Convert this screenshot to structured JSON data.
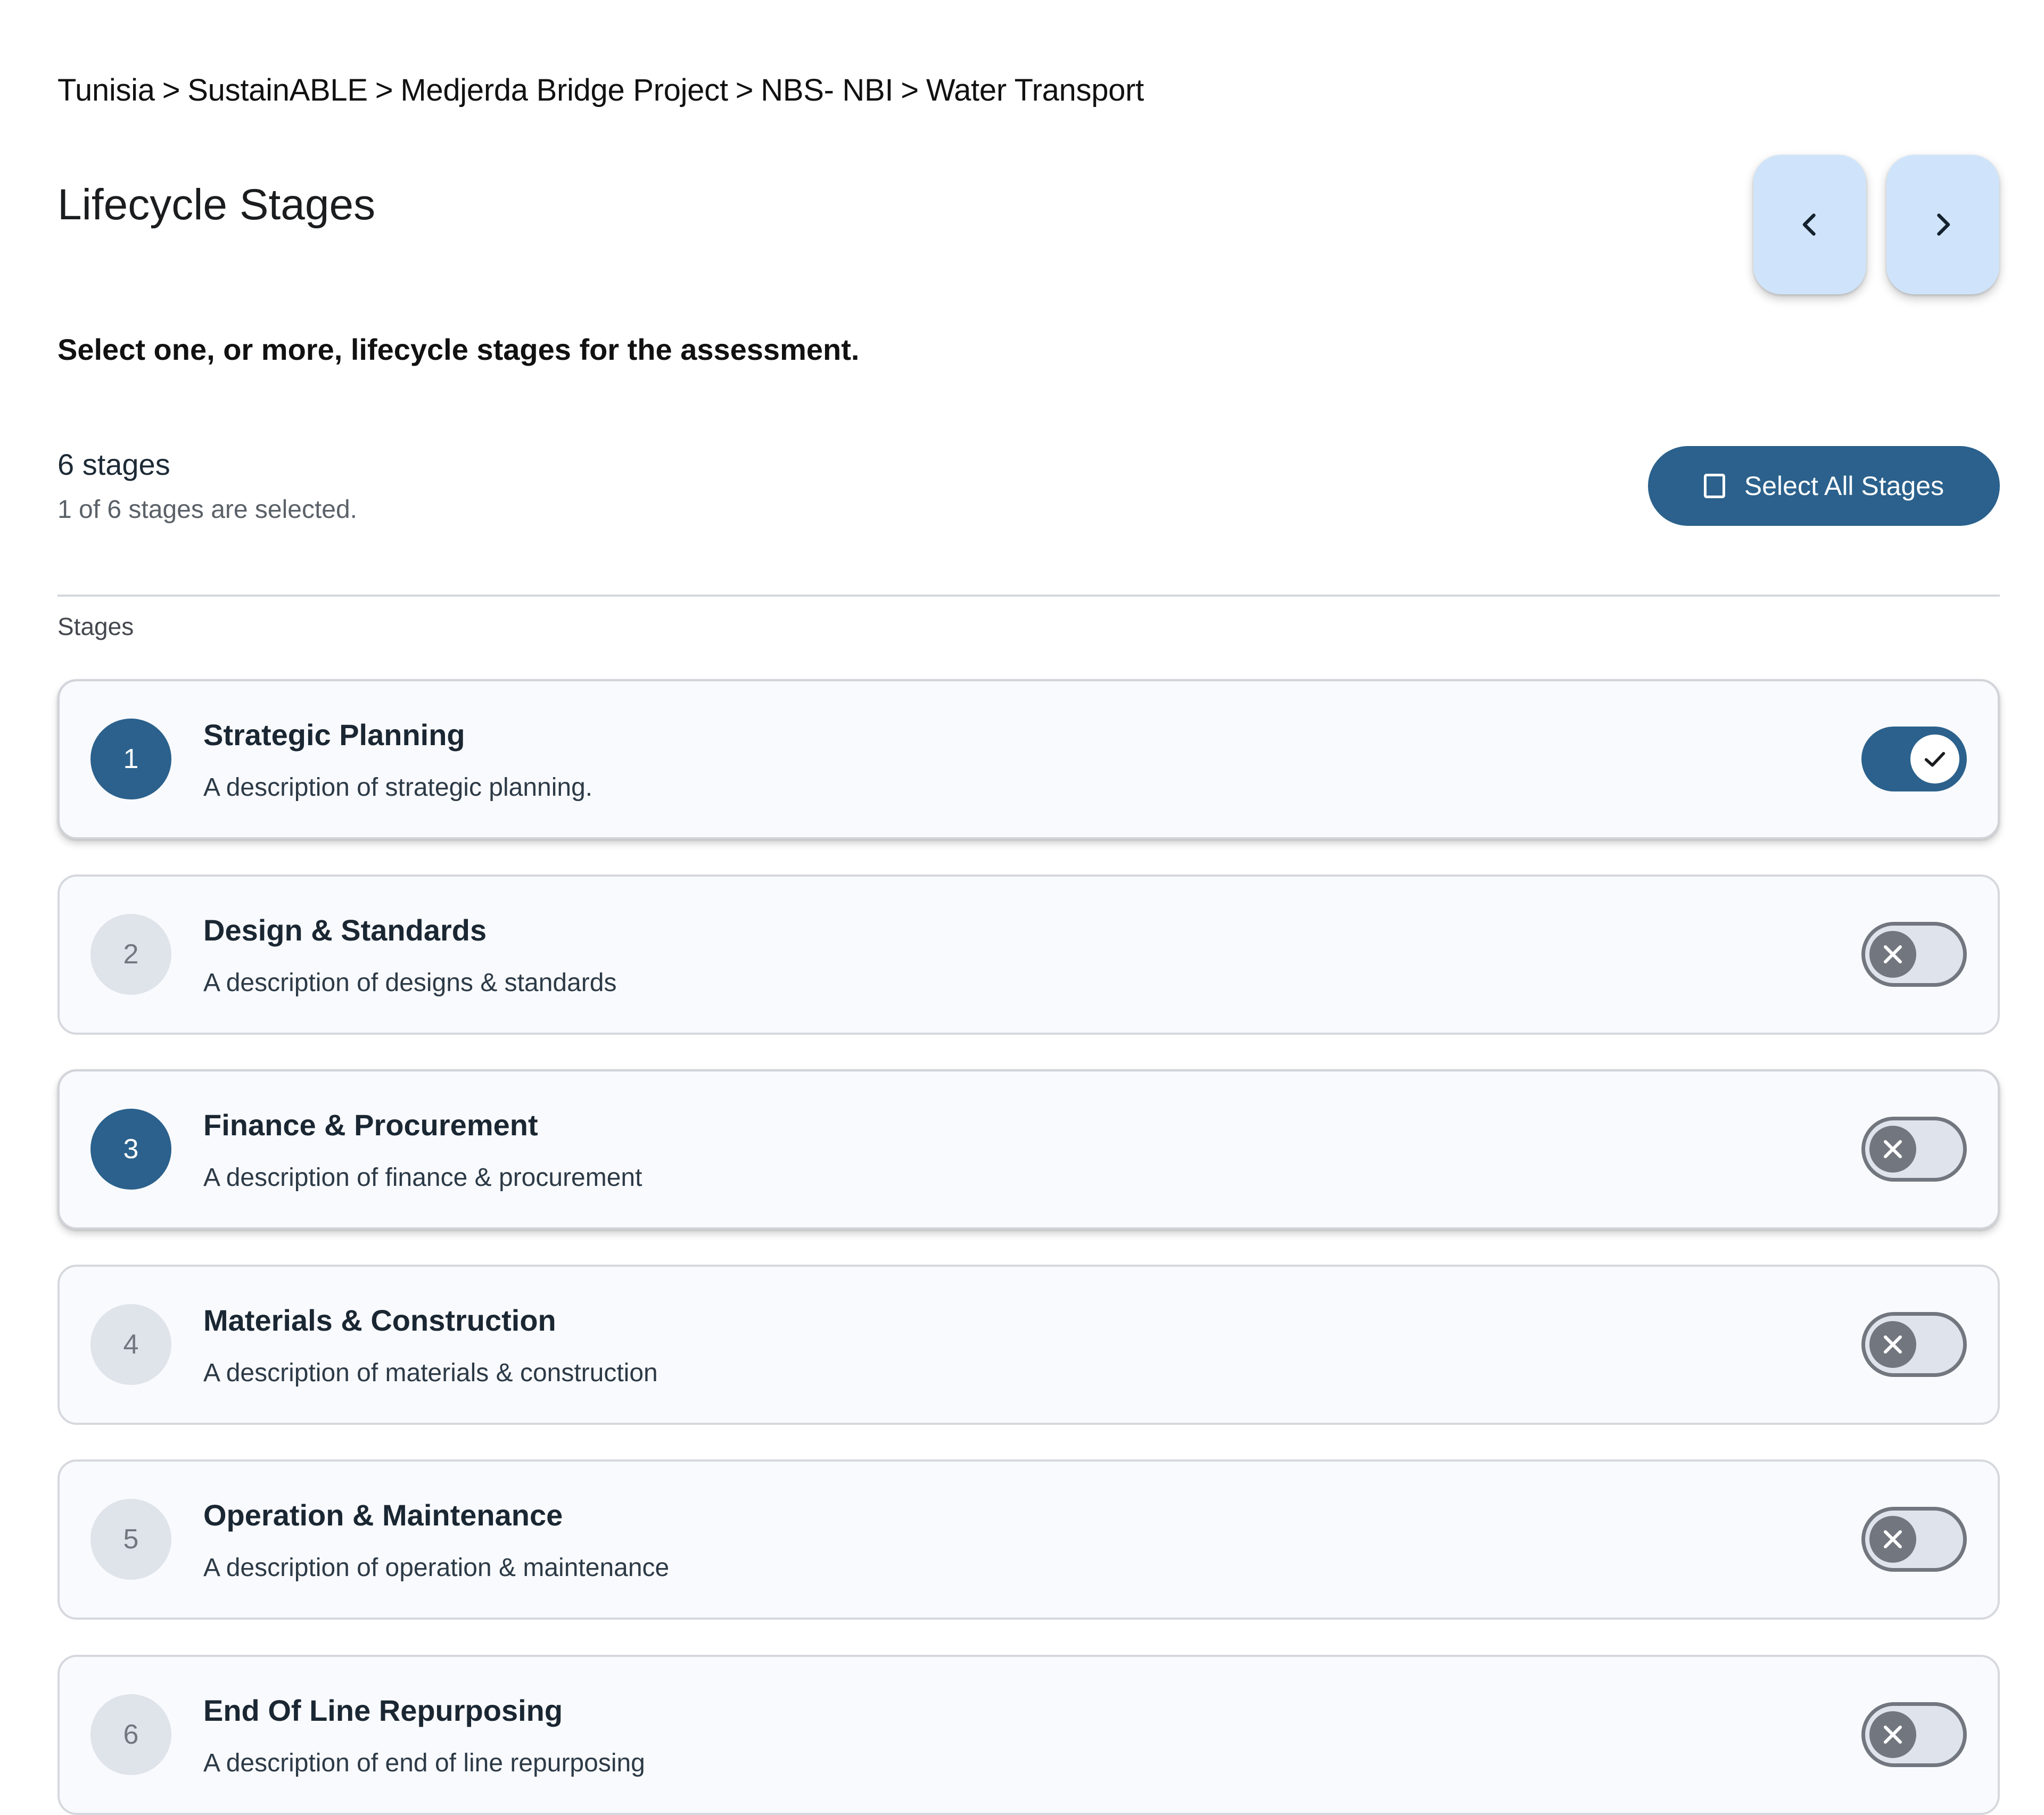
{
  "breadcrumb": {
    "items": [
      "Tunisia",
      "SustainABLE",
      "Medjerda Bridge Project",
      "NBS- NBI",
      "Water Transport"
    ],
    "separator": ">"
  },
  "header": {
    "title": "Lifecycle Stages",
    "prev_icon": "chevron-left-icon",
    "next_icon": "chevron-right-icon"
  },
  "instruction": "Select one, or more, lifecycle stages for the assessment.",
  "summary": {
    "count_label": "6 stages",
    "selected_label": "1 of 6 stages are selected.",
    "select_all_label": "Select All Stages",
    "select_all_icon": "checkbox-outline-icon"
  },
  "section_label": "Stages",
  "colors": {
    "primary": "#2b618c",
    "nav_button": "#cfe4fa",
    "inactive_badge": "#dfe3ea",
    "toggle_off": "#72777f",
    "card_background": "#f9fafe"
  },
  "stages": [
    {
      "number": "1",
      "title": "Strategic Planning",
      "description": "A description of strategic planning.",
      "selected": true,
      "badge_active": true
    },
    {
      "number": "2",
      "title": "Design & Standards",
      "description": "A description of designs & standards",
      "selected": false,
      "badge_active": false
    },
    {
      "number": "3",
      "title": "Finance & Procurement",
      "description": "A description of finance & procurement",
      "selected": false,
      "badge_active": true
    },
    {
      "number": "4",
      "title": "Materials & Construction",
      "description": "A description of materials & construction",
      "selected": false,
      "badge_active": false
    },
    {
      "number": "5",
      "title": "Operation & Maintenance",
      "description": "A description of operation & maintenance",
      "selected": false,
      "badge_active": false
    },
    {
      "number": "6",
      "title": "End Of Line Repurposing",
      "description": "A description of end of line repurposing",
      "selected": false,
      "badge_active": false
    }
  ]
}
